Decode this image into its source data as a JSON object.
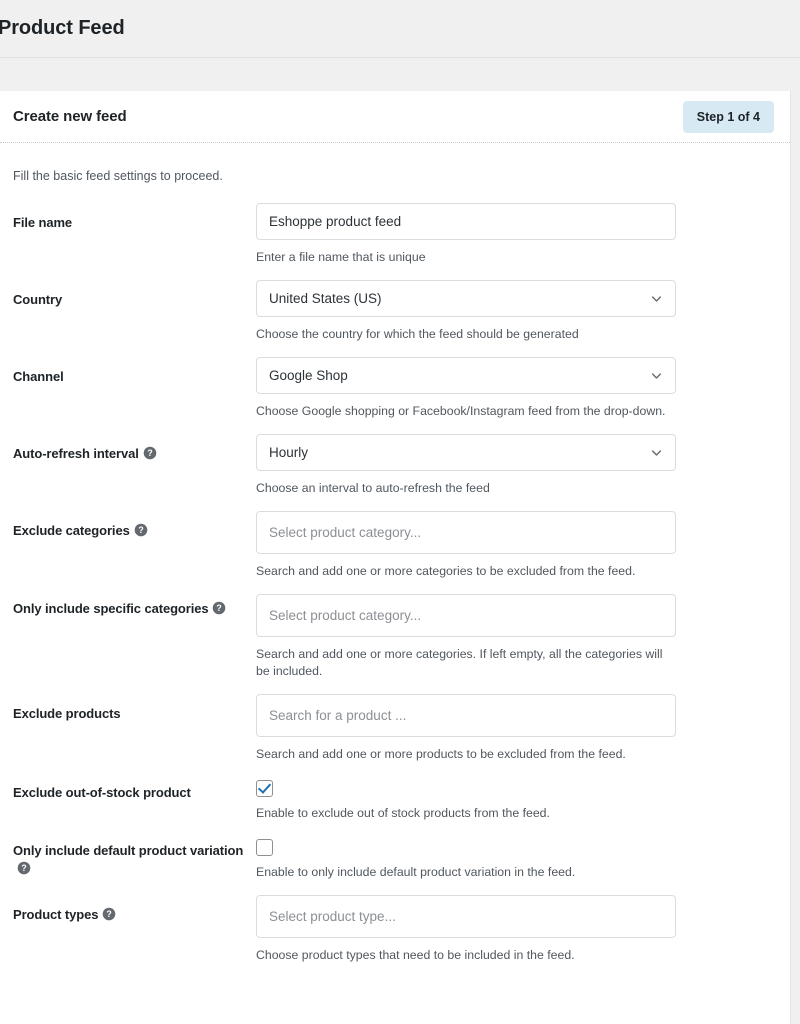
{
  "header": {
    "title": "Product Feed"
  },
  "card": {
    "heading": "Create new feed",
    "step_badge": "Step 1 of 4",
    "intro": "Fill the basic feed settings to proceed."
  },
  "colors": {
    "badge_bg": "#d7e9f3",
    "checkbox_check": "#2271b1",
    "page_bg": "#f0f0f1",
    "card_bg": "#ffffff",
    "border": "#dcdcde"
  },
  "fields": [
    {
      "label": "File name",
      "type": "text",
      "value": "Eshoppe product feed",
      "placeholder": "",
      "hint": "Enter a file name that is unique",
      "has_help": false
    },
    {
      "label": "Country",
      "type": "select",
      "value": "United States (US)",
      "hint": "Choose the country for which the feed should be generated",
      "has_help": false
    },
    {
      "label": "Channel",
      "type": "select",
      "value": "Google Shop",
      "hint": "Choose Google shopping or Facebook/Instagram feed from the drop-down.",
      "has_help": false
    },
    {
      "label": "Auto-refresh interval",
      "type": "select",
      "value": "Hourly",
      "hint": "Choose an interval to auto-refresh the feed",
      "has_help": true
    },
    {
      "label": "Exclude categories",
      "type": "tokens",
      "value": "",
      "placeholder": "Select product category...",
      "hint": "Search and add one or more categories to be excluded from the feed.",
      "has_help": true
    },
    {
      "label": "Only include specific categories",
      "type": "tokens",
      "value": "",
      "placeholder": "Select product category...",
      "hint": "Search and add one or more categories. If left empty, all the categories will be included.",
      "has_help": true
    },
    {
      "label": "Exclude products",
      "type": "tokens",
      "value": "",
      "placeholder": "Search for a product ...",
      "hint": "Search and add one or more products to be excluded from the feed.",
      "has_help": false
    },
    {
      "label": "Exclude out-of-stock product",
      "type": "checkbox",
      "checked": true,
      "hint": "Enable to exclude out of stock products from the feed.",
      "has_help": false
    },
    {
      "label": "Only include default product variation",
      "type": "checkbox",
      "checked": false,
      "hint": "Enable to only include default product variation in the feed.",
      "has_help": true
    },
    {
      "label": "Product types",
      "type": "tokens",
      "value": "",
      "placeholder": "Select product type...",
      "hint": "Choose product types that need to be included in the feed.",
      "has_help": true
    }
  ],
  "icons": {
    "help": "help-circle-icon",
    "chevron": "chevron-down-icon"
  }
}
